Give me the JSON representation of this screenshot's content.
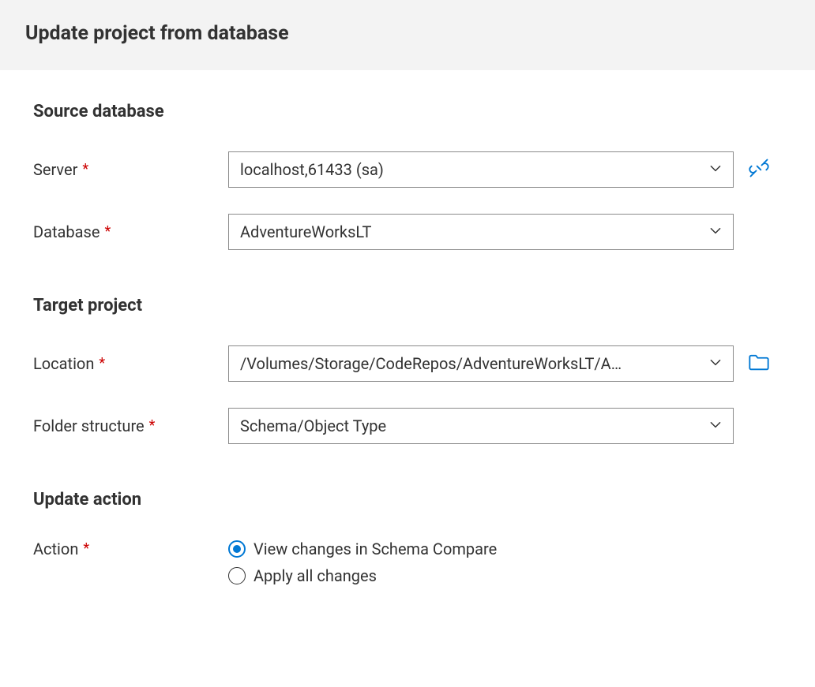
{
  "header": {
    "title": "Update project from database"
  },
  "sections": {
    "source": {
      "title": "Source database",
      "server": {
        "label": "Server",
        "value": "localhost,61433 (sa)"
      },
      "database": {
        "label": "Database",
        "value": "AdventureWorksLT"
      }
    },
    "target": {
      "title": "Target project",
      "location": {
        "label": "Location",
        "value": "/Volumes/Storage/CodeRepos/AdventureWorksLT/A…"
      },
      "folder_structure": {
        "label": "Folder structure",
        "value": "Schema/Object Type"
      }
    },
    "action": {
      "title": "Update action",
      "label": "Action",
      "options": {
        "view_changes": "View changes in Schema Compare",
        "apply_all": "Apply all changes"
      },
      "selected": "view_changes"
    }
  }
}
